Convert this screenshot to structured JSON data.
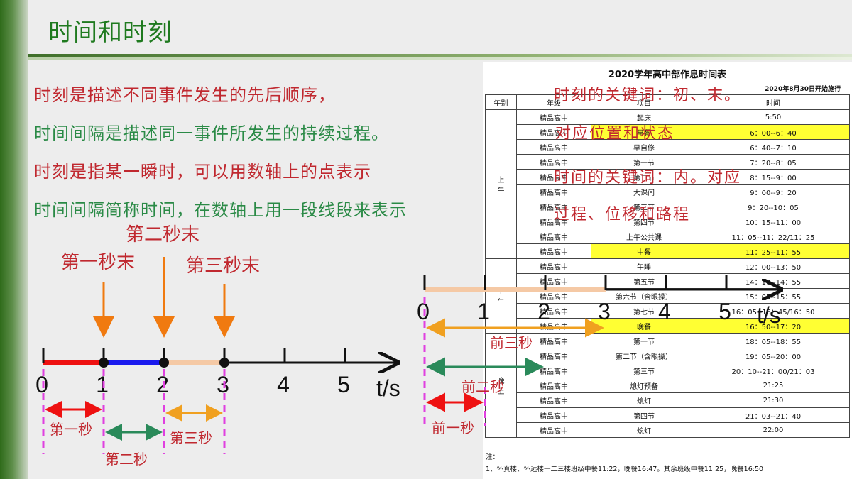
{
  "slide": {
    "title": "时间和时刻",
    "lines": [
      "时刻是描述不同事件发生的先后顺序，",
      "时间间隔是描述同一事件所发生的持续过程。",
      "时刻是指某一瞬时，可以用数轴上的点表示",
      "时间间隔简称时间，在数轴上用一段线段来表示"
    ]
  },
  "left_axis": {
    "ticks": [
      "0",
      "1",
      "2",
      "3",
      "4",
      "5"
    ],
    "unit": "t/s",
    "moments": [
      "第一秒末",
      "第二秒末",
      "第三秒末"
    ],
    "intervals": [
      "第一秒",
      "第二秒",
      "第三秒"
    ],
    "colors": {
      "sec1": "#ee1111",
      "sec2": "#1a1aee",
      "sec3": "#f5c9a5",
      "arrow": "#f07a10",
      "magenta": "#e040e0"
    }
  },
  "right_axis": {
    "ticks": [
      "0",
      "1",
      "2",
      "3",
      "4",
      "5"
    ],
    "unit": "t/s",
    "intervals": [
      "前三秒",
      "前二秒",
      "前一秒"
    ]
  },
  "schedule": {
    "title": "2020学年高中部作息时间表",
    "date_note": "2020年8月30日开始施行",
    "headers": [
      "午别",
      "年级",
      "项目",
      "时间"
    ],
    "period_am": "上\n午",
    "period_pm": "下\n午",
    "period_eve": "晚\n上",
    "rows": [
      [
        "精品高中",
        "起床",
        "5:50"
      ],
      [
        "精品高中",
        "早餐",
        "6：00--6：40"
      ],
      [
        "精品高中",
        "早自修",
        "6：40--7：10"
      ],
      [
        "精品高中",
        "第一节",
        "7：20--8：05"
      ],
      [
        "精品高中",
        "第二节",
        "8：15--9：00"
      ],
      [
        "精品高中",
        "大课间",
        "9：00--9：20"
      ],
      [
        "精品高中",
        "第三节",
        "9：20--10：05"
      ],
      [
        "精品高中",
        "第四节",
        "10：15--11：00"
      ],
      [
        "精品高中",
        "上午公共课",
        "11：05--11：22/11：25"
      ],
      [
        "精品高中",
        "中餐",
        "11：25--11：55"
      ],
      [
        "精品高中",
        "午睡",
        "12：00--13：50"
      ],
      [
        "精品高中",
        "第五节",
        "14：10--14：55"
      ],
      [
        "精品高中",
        "第六节（含眼操）",
        "15：05--15：55"
      ],
      [
        "精品高中",
        "第七节",
        "16：05--16：45/16：50"
      ],
      [
        "精品高中",
        "晚餐",
        "16：50--17：20"
      ],
      [
        "精品高中",
        "第一节",
        "18：05--18：55"
      ],
      [
        "精品高中",
        "第二节（含眼操）",
        "19：05--20：00"
      ],
      [
        "精品高中",
        "第三节",
        "20：10--21：00/21：03"
      ],
      [
        "精品高中",
        "熄灯预备",
        "21:25"
      ],
      [
        "精品高中",
        "熄灯",
        "21:30"
      ],
      [
        "精品高中",
        "第四节",
        "21：03--21：40"
      ],
      [
        "精品高中",
        "熄灯",
        "22:00"
      ]
    ],
    "highlight_rows": [
      1,
      9,
      14
    ],
    "notes": [
      "注：",
      "1、怀真楼、怀远楼一二三楼班级中餐11:22，晚餐16:47。其余班级中餐11:25，晚餐16:50"
    ]
  },
  "overlay_notes": [
    "时刻的关键词：初、末。",
    "对应位置和状态",
    "时间的关键词：内。对应",
    "过程、位移和路程"
  ]
}
